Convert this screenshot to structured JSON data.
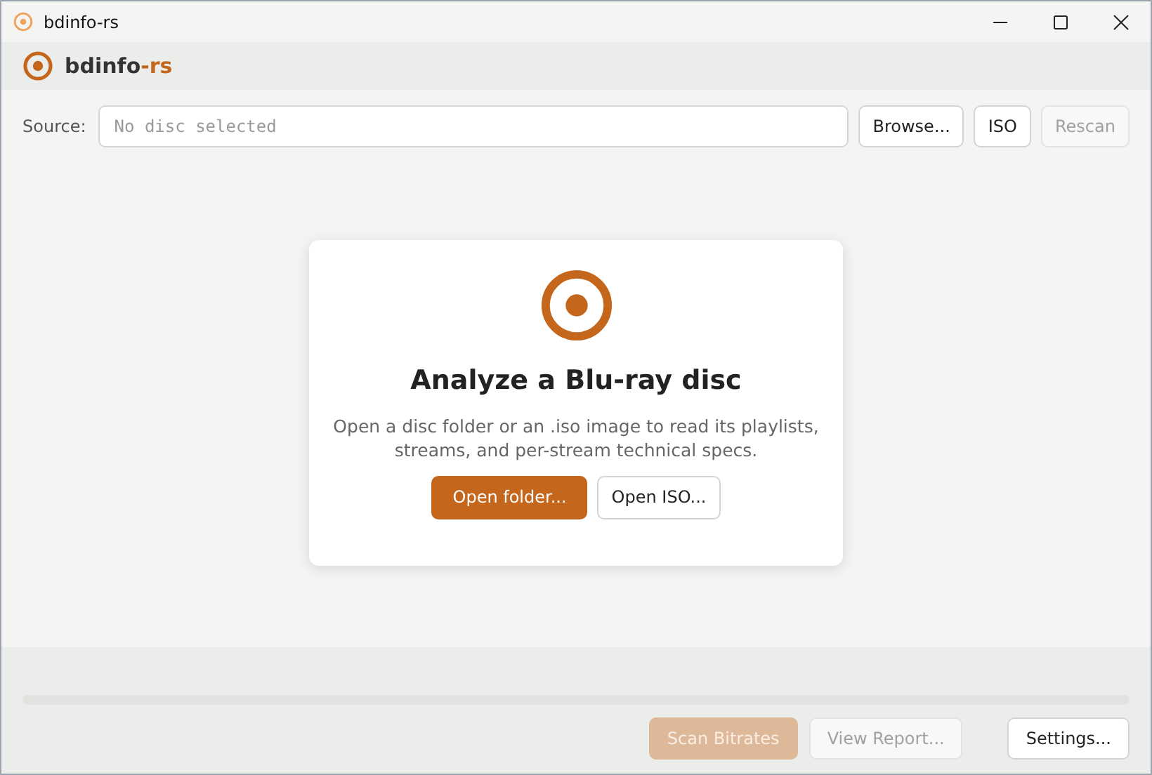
{
  "window": {
    "title": "bdinfo-rs"
  },
  "app_header": {
    "name": "bdinfo",
    "suffix": "-rs"
  },
  "source": {
    "label": "Source:",
    "placeholder": "No disc selected"
  },
  "source_buttons": [
    {
      "label": "Browse...",
      "disabled": false
    },
    {
      "label": "ISO",
      "disabled": false
    },
    {
      "label": "Rescan",
      "disabled": true
    }
  ],
  "empty_state": {
    "title": "Analyze a Blu-ray disc",
    "description": "Open a disc folder or an .iso image to read its playlists, streams, and per-stream technical specs.",
    "buttons": [
      {
        "label": "Open folder...",
        "kind": "primary"
      },
      {
        "label": "Open ISO...",
        "kind": "secondary"
      }
    ]
  },
  "progress": {
    "level": 0
  },
  "footer_buttons": [
    {
      "label": "Scan Bitrates",
      "kind": "primary",
      "disabled": true
    },
    {
      "label": "View Report...",
      "kind": "secondary",
      "disabled": true
    },
    {
      "label": "Settings...",
      "kind": "secondary",
      "disabled": false
    }
  ]
}
